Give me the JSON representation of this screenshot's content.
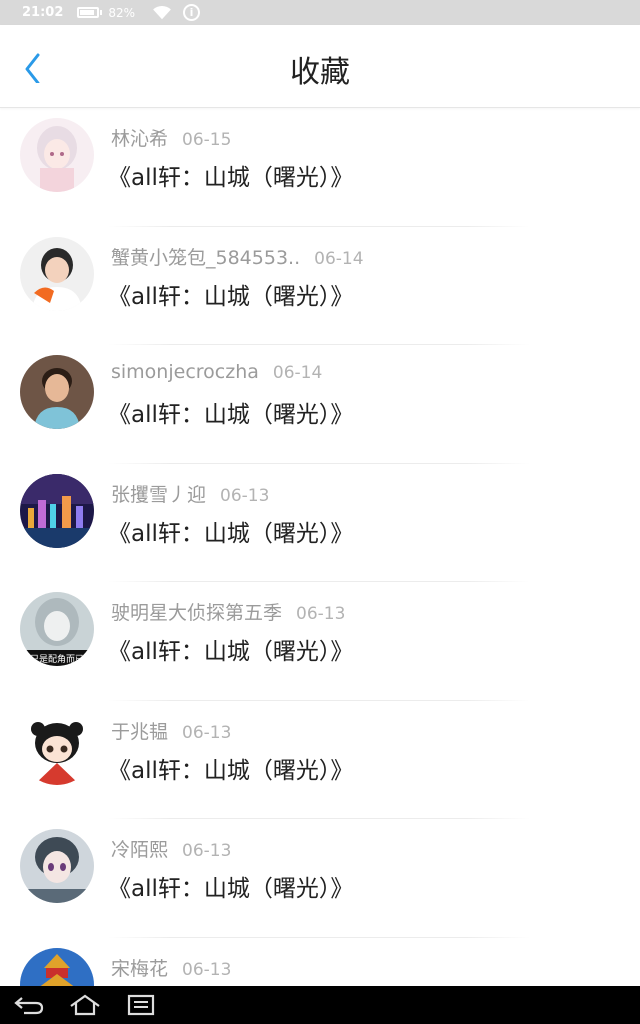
{
  "status_bar": {
    "time": "21:02",
    "battery": "82%"
  },
  "header": {
    "title": "收藏"
  },
  "favorites": [
    {
      "user": "林沁希",
      "date": "06-15",
      "title": "《all轩：山城（曙光）》",
      "avatar": "anime-girl-pink"
    },
    {
      "user": "蟹黄小笼包_584553..",
      "date": "06-14",
      "title": "《all轩：山城（曙光）》",
      "avatar": "boy-orange-scarf"
    },
    {
      "user": "simonjecroczha",
      "date": "06-14",
      "title": "《all轩：山城（曙光）》",
      "avatar": "smiling-boy"
    },
    {
      "user": "张攫雪丿迎",
      "date": "06-13",
      "title": "《all轩：山城（曙光）》",
      "avatar": "city-night"
    },
    {
      "user": "驶明星大侦探第五季",
      "date": "06-13",
      "title": "《all轩：山城（曙光）》",
      "avatar": "pale-girl",
      "avatar_caption": "只是配角而已"
    },
    {
      "user": "于兆韫",
      "date": "06-13",
      "title": "《all轩：山城（曙光）》",
      "avatar": "cartoon-girl-fan"
    },
    {
      "user": "冷陌熙",
      "date": "06-13",
      "title": "《all轩：山城（曙光）》",
      "avatar": "anime-boy"
    },
    {
      "user": "宋梅花",
      "date": "06-13",
      "title": "",
      "avatar": "pagoda"
    }
  ],
  "colors": {
    "accent": "#2a9ae8",
    "username": "#9b9b9b",
    "title": "#222222"
  }
}
